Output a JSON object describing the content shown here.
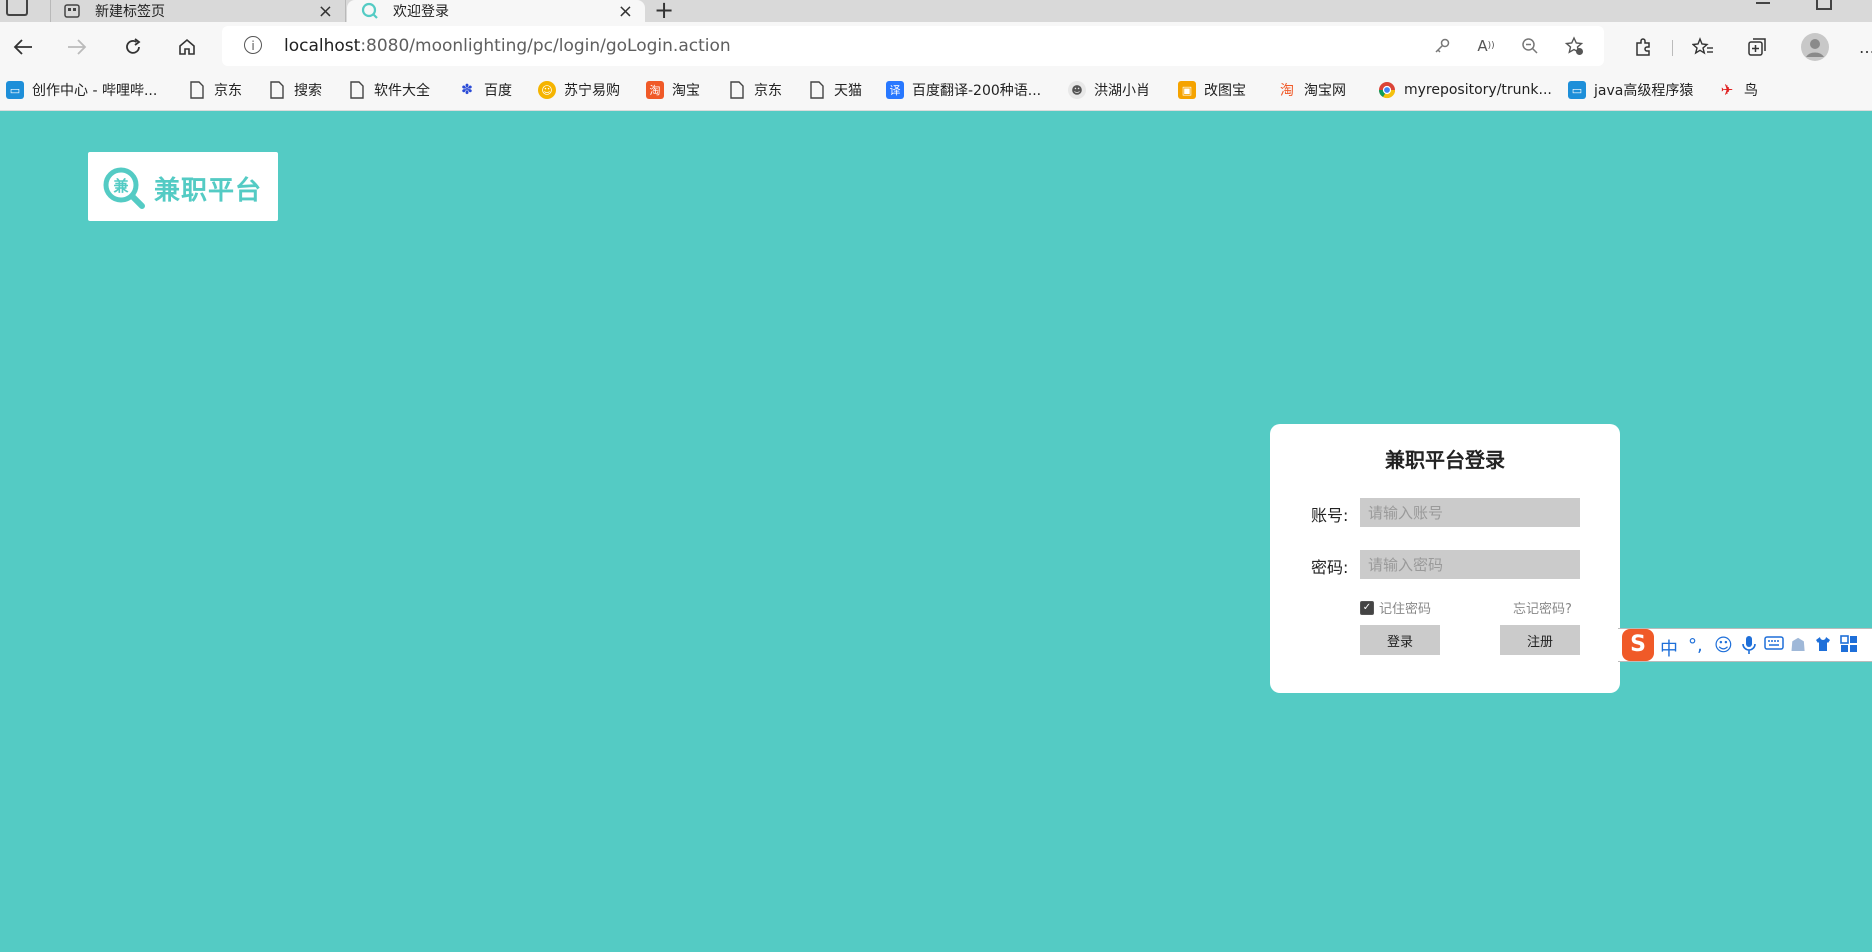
{
  "browser": {
    "tabs": [
      {
        "label": "新建标签页",
        "active": false
      },
      {
        "label": "欢迎登录",
        "active": true
      }
    ],
    "url_host": "localhost",
    "url_rest": ":8080/moonlighting/pc/login/goLogin.action"
  },
  "bookmarks": [
    {
      "label": "创作中心 - 哔哩哔...",
      "icon": "bilibili-icon",
      "color": "#1e8fd9"
    },
    {
      "label": "京东",
      "icon": "page-icon"
    },
    {
      "label": "搜索",
      "icon": "page-icon"
    },
    {
      "label": "软件大全",
      "icon": "page-icon"
    },
    {
      "label": "百度",
      "icon": "baidu-icon",
      "color": "#2a4bd7"
    },
    {
      "label": "苏宁易购",
      "icon": "suning-icon",
      "color": "#f5b400"
    },
    {
      "label": "淘宝",
      "icon": "taobao-icon",
      "color": "#f05a28"
    },
    {
      "label": "京东",
      "icon": "page-icon"
    },
    {
      "label": "天猫",
      "icon": "page-icon"
    },
    {
      "label": "百度翻译-200种语...",
      "icon": "translate-icon",
      "color": "#2878ff"
    },
    {
      "label": "洪湖小肖",
      "icon": "avatar-icon"
    },
    {
      "label": "改图宝",
      "icon": "gaitubao-icon",
      "color": "#f5a300"
    },
    {
      "label": "淘宝网",
      "icon": "taobao-icon",
      "color": "#f05a28"
    },
    {
      "label": "myrepository/trunk...",
      "icon": "chrome-icon"
    },
    {
      "label": "java高级程序猿",
      "icon": "bilibili-icon",
      "color": "#1e8fd9"
    },
    {
      "label": "鸟",
      "icon": "bird-icon",
      "color": "#e02020"
    }
  ],
  "logo": {
    "mark": "兼",
    "text": "兼职平台"
  },
  "login": {
    "title": "兼职平台登录",
    "account_label": "账号:",
    "account_placeholder": "请输入账号",
    "password_label": "密码:",
    "password_placeholder": "请输入密码",
    "remember_label": "记住密码",
    "remember_checked": true,
    "forgot_label": "忘记密码?",
    "login_button": "登录",
    "register_button": "注册"
  },
  "ime": {
    "logo": "S",
    "mode": "中",
    "punct": "°,"
  },
  "colors": {
    "background": "#54cbc4",
    "input": "#cbcbcb",
    "ime_accent": "#1e6fd9"
  }
}
